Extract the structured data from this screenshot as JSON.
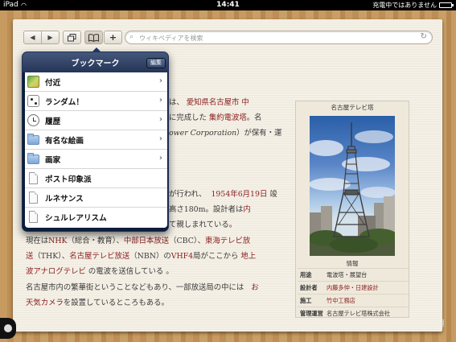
{
  "status": {
    "device": "iPad",
    "time": "14:41",
    "charging": "充電中ではありません"
  },
  "toolbar": {
    "back": "◀",
    "forward": "▶",
    "tabs": "⧉",
    "bookmarks": "📖",
    "add": "+",
    "search_placeholder": "ウィキペディアを検索",
    "search_icon": "🔍",
    "reload": "↻"
  },
  "popover": {
    "title": "ブックマーク",
    "edit": "編集",
    "items": [
      {
        "label": "付近",
        "icon": "map-icon",
        "chevron": true
      },
      {
        "label": "ランダム！",
        "icon": "dice-icon",
        "chevron": true
      },
      {
        "label": "履歴",
        "icon": "clock-icon",
        "chevron": true
      },
      {
        "label": "有名な絵画",
        "icon": "folder-icon",
        "chevron": true
      },
      {
        "label": "画家",
        "icon": "folder-icon",
        "chevron": true
      },
      {
        "label": "ポスト印象派",
        "icon": "page-icon",
        "chevron": false
      },
      {
        "label": "ルネサンス",
        "icon": "page-icon",
        "chevron": false
      },
      {
        "label": "シュルレアリスム",
        "icon": "page-icon",
        "chevron": false
      }
    ]
  },
  "article": {
    "p1": {
      "pre": "は、",
      "link1": "愛知県",
      "link2": "名古屋市",
      "link3": "中",
      "l2_a": "に完成した",
      "link4": "集約電波塔",
      "l2_b": "。名",
      "l3_a": "ower Corporation",
      "l3_b": "）が保有・運"
    },
    "p2": {
      "l1_a": "が行われ、",
      "link1": "1954年6月19日",
      "l1_b": "竣",
      "l2": "高さ180m。設計者は",
      "link2": "内",
      "l3": "て親しまれている。"
    },
    "p3": {
      "l1_a": "現在は",
      "nhk": "NHK",
      "l1_b": "（総合・教育）、",
      "cbc": "中部日本放送",
      "l1_c": "（CBC）、",
      "thk": "東海テレビ放",
      "l2_a": "送",
      "l2_b": "（THK）、",
      "nbn": "名古屋テレビ放送",
      "l2_c": "（NBN）の",
      "vhf": "VHF4",
      "l2_d": "局がここから",
      "chijo": "地上",
      "l3_a": "波アナログテレビ",
      "l3_b": "の電波を送信している 。"
    },
    "p4": {
      "l1": "名古屋市内の繁華街ということなどもあり、一部放送局の中には",
      "link": "お",
      "link2": "天気カメラ",
      "l2": "を設置しているところもある。"
    }
  },
  "infobox": {
    "title": "名古屋テレビ塔",
    "section": "情報",
    "rows": [
      {
        "k": "用途",
        "v": "電波塔・展望台",
        "link": false
      },
      {
        "k": "設計者",
        "v": "内藤多仲・日建設計",
        "link": true
      },
      {
        "k": "施工",
        "v": "竹中工務店",
        "link": true
      },
      {
        "k": "管理運営",
        "v": "名古屋テレビ塔株式会社",
        "link": false
      }
    ]
  }
}
